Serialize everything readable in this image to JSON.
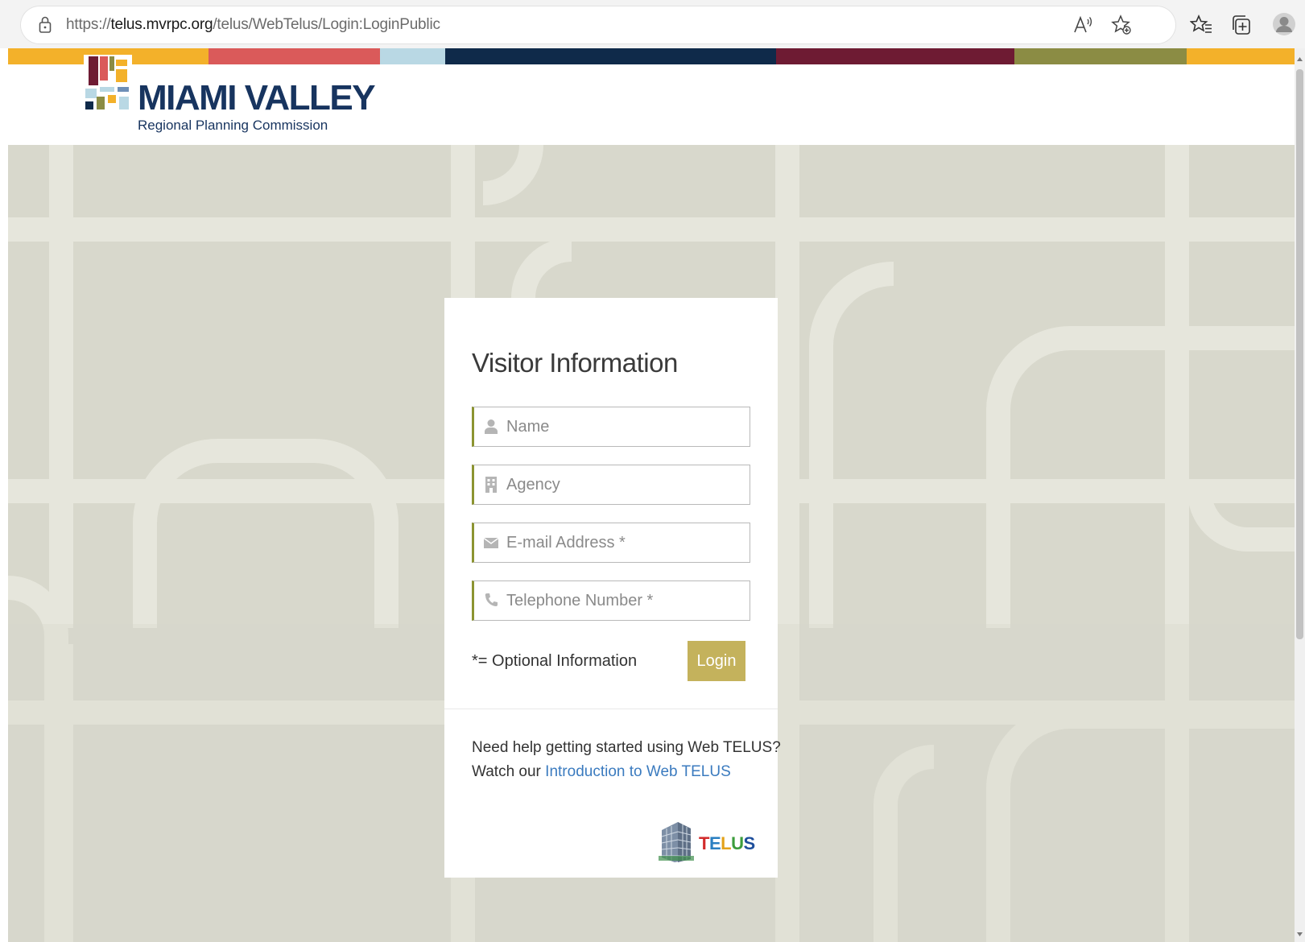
{
  "browser": {
    "url_prefix": "https://",
    "url_host": "telus.mvrpc.org",
    "url_path": "/telus/WebTelus/Login:LoginPublic",
    "icons": [
      "lock-icon",
      "read-aloud-icon",
      "add-favorite-icon",
      "favorites-icon",
      "collections-icon",
      "profile-icon"
    ]
  },
  "stripe_colors": [
    "#f3b12a",
    "#da5a5a",
    "#b9d8e4",
    "#0f2a4a",
    "#6e1b33",
    "#8b8c44",
    "#f3b12a"
  ],
  "header": {
    "logo_title": "MIAMI VALLEY",
    "logo_subtitle": "Regional Planning Commission",
    "brand_color": "#17345f"
  },
  "card": {
    "title": "Visitor Information",
    "fields": [
      {
        "placeholder": "Name",
        "icon": "user-icon"
      },
      {
        "placeholder": "Agency",
        "icon": "building-icon"
      },
      {
        "placeholder": "E-mail Address *",
        "icon": "envelope-icon"
      },
      {
        "placeholder": "Telephone Number *",
        "icon": "phone-icon"
      }
    ],
    "optional_note": "*= Optional Information",
    "login_label": "Login",
    "help_line1": "Need help getting started using Web TELUS?",
    "help_line2_prefix": "Watch our ",
    "help_link": "Introduction to Web TELUS",
    "telus_letters": [
      "T",
      "E",
      "L",
      "U",
      "S"
    ],
    "telus_colors": [
      "#d22b2b",
      "#2a7fc1",
      "#e3a21a",
      "#3c9c3c",
      "#1e4f9c"
    ],
    "accent_color": "#8c9431",
    "button_color": "#c4b25c",
    "link_color": "#3b7bbf"
  }
}
